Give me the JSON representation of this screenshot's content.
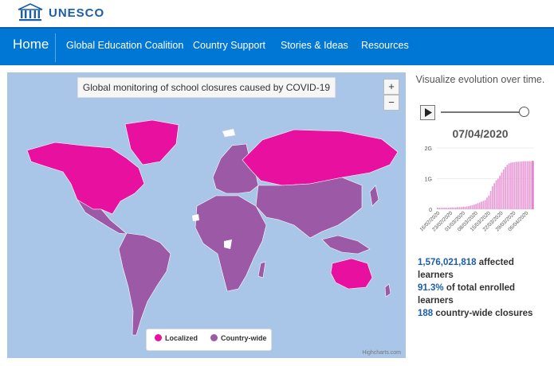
{
  "header": {
    "brand": "UNESCO",
    "logo_icon": "unesco-temple-icon"
  },
  "nav": {
    "home": "Home",
    "items": [
      "Global Education Coalition",
      "Country Support",
      "Stories & Ideas",
      "Resources"
    ]
  },
  "map": {
    "title": "Global monitoring of school closures caused by COVID-19",
    "zoom_in": "+",
    "zoom_out": "−",
    "legend": [
      {
        "label": "Localized",
        "color": "#e8119f"
      },
      {
        "label": "Country-wide",
        "color": "#9b59a6"
      }
    ],
    "credit": "Highcharts.com",
    "colors": {
      "ocean": "#a9c6e8",
      "localized": "#e8119f",
      "countrywide": "#9b59a6",
      "other": "#ffffff"
    }
  },
  "side": {
    "title": "Visualize evolution over time.",
    "play_icon": "play-icon",
    "slider_value": 1.0,
    "date": "07/04/2020",
    "stats": {
      "learners_num": "1,576,021,818",
      "learners_text1": "affected",
      "learners_text2": "learners",
      "pct_num": "91.3%",
      "pct_text1": "of total enrolled",
      "pct_text2": "learners",
      "closures_num": "188",
      "closures_text": "country-wide closures"
    }
  },
  "chart_data": {
    "type": "bar",
    "title": "",
    "xlabel": "",
    "ylabel": "",
    "y_tick_labels": [
      "2G",
      "1G",
      "0"
    ],
    "ylim": [
      0,
      2000000000
    ],
    "categories": [
      "16/02/2020",
      "23/02/2020",
      "01/03/2020",
      "08/03/2020",
      "15/03/2020",
      "22/03/2020",
      "29/03/2020",
      "05/04/2020"
    ],
    "series": [
      {
        "values": [
          0.05,
          0.05,
          0.05,
          0.05,
          0.05,
          0.05,
          0.05,
          0.06,
          0.06,
          0.06,
          0.06,
          0.07,
          0.07,
          0.07,
          0.08,
          0.08,
          0.09,
          0.1,
          0.12,
          0.13,
          0.15,
          0.17,
          0.2,
          0.22,
          0.25,
          0.27,
          0.3,
          0.38,
          0.45,
          0.6,
          0.75,
          0.85,
          0.95,
          1.0,
          1.1,
          1.2,
          1.3,
          1.38,
          1.45,
          1.5,
          1.52,
          1.53,
          1.54,
          1.55,
          1.55,
          1.56,
          1.56,
          1.57,
          1.57,
          1.57,
          1.57,
          1.57,
          1.58
        ],
        "unit": "billion"
      }
    ]
  }
}
